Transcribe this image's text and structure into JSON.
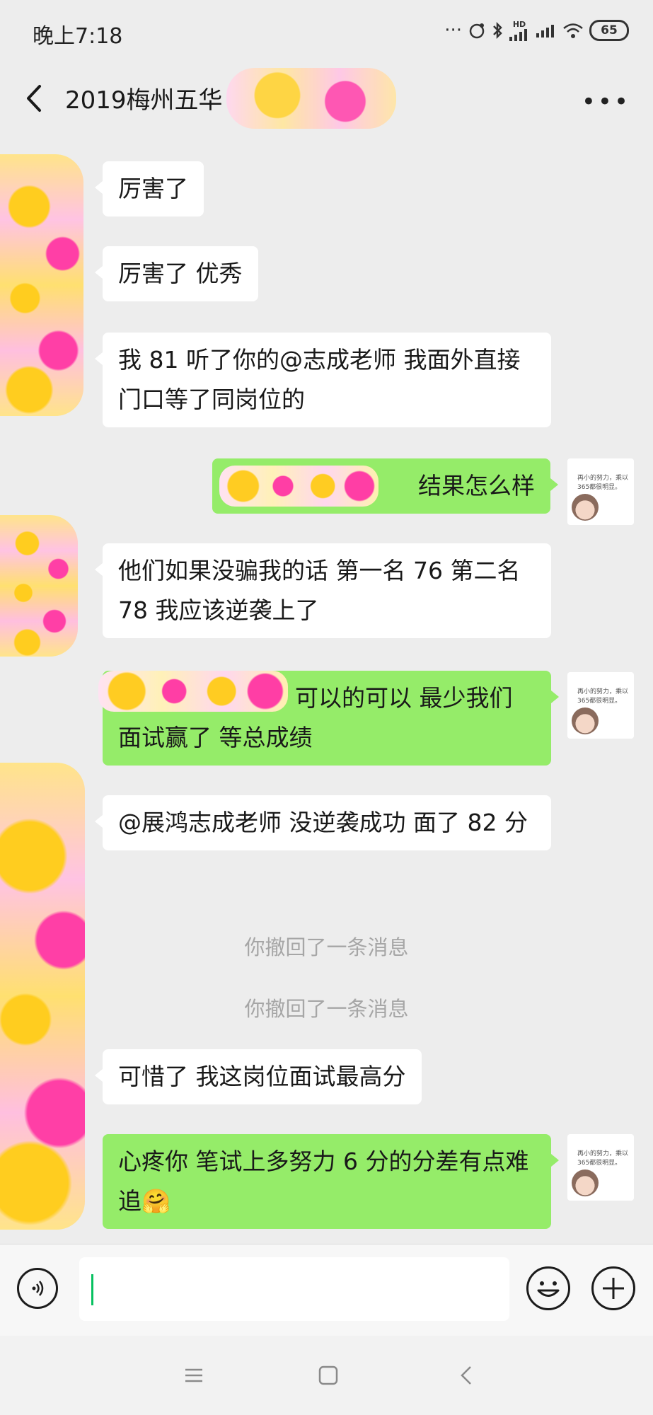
{
  "status_bar": {
    "time": "晚上7:18",
    "network": "HD",
    "battery": "65",
    "icons": [
      "dots-icon",
      "alarm-icon",
      "bluetooth-icon",
      "signal-icon",
      "signal-icon",
      "wifi-icon",
      "battery-icon"
    ]
  },
  "header": {
    "title": "2019梅州五华",
    "back_icon": "chevron-left-icon",
    "more_icon": "more-dots-icon"
  },
  "messages": [
    {
      "side": "in",
      "text": "厉害了"
    },
    {
      "side": "in",
      "text": "厉害了  优秀"
    },
    {
      "side": "in",
      "text": "我 81 听了你的@志成老师  我面外直接门口等了同岗位的"
    },
    {
      "side": "out",
      "text": "结果怎么样"
    },
    {
      "side": "in",
      "text": "他们如果没骗我的话  第一名 76  第二名 78   我应该逆袭上了"
    },
    {
      "side": "out",
      "text": "可以的可以  最少我们面试赢了  等总成绩"
    },
    {
      "side": "in",
      "text": "@展鸿志成老师 没逆袭成功  面了 82 分"
    },
    {
      "side": "system",
      "text": "你撤回了一条消息"
    },
    {
      "side": "system",
      "text": "你撤回了一条消息"
    },
    {
      "side": "in",
      "text": "可惜了  我这岗位面试最高分"
    },
    {
      "side": "out",
      "text": "心疼你  笔试上多努力  6 分的分差有点难追"
    }
  ],
  "avatar_caption": "再小的努力，乘以365都很明显。",
  "emoji": "🤗",
  "input_bar": {
    "voice_icon": "voice-icon",
    "emoji_icon": "emoji-icon",
    "plus_icon": "plus-icon",
    "input_value": ""
  },
  "nav_bar": [
    "menu-icon",
    "home-icon",
    "back-icon"
  ],
  "colors": {
    "background": "#ededed",
    "bubble_out": "#95ec69",
    "bubble_in": "#ffffff",
    "cursor": "#07c160"
  }
}
